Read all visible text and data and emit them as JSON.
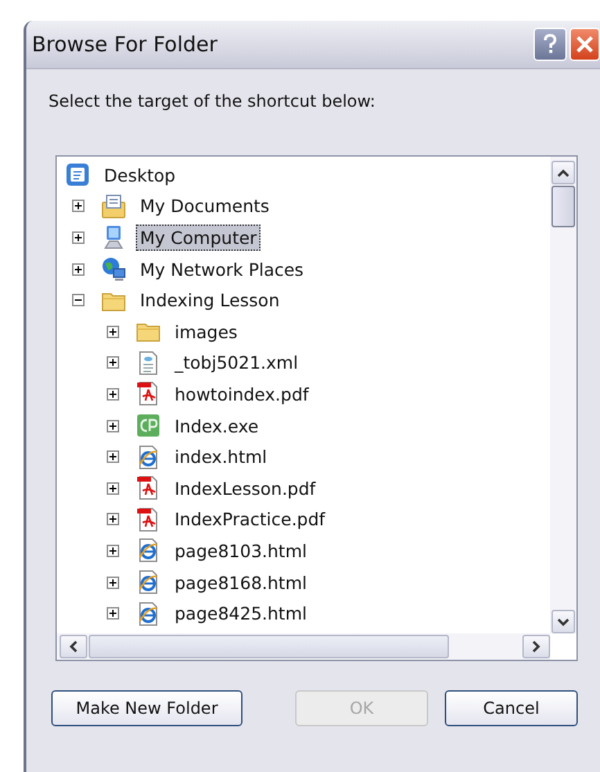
{
  "window": {
    "title": "Browse For Folder"
  },
  "instruction": "Select the target of the shortcut below:",
  "tree": {
    "label": "Desktop",
    "kind": "desktop",
    "selected": false,
    "children": [
      {
        "label": "My Documents",
        "kind": "documents",
        "expanded": false,
        "selected": false
      },
      {
        "label": "My Computer",
        "kind": "computer",
        "expanded": false,
        "selected": true
      },
      {
        "label": "My Network Places",
        "kind": "network",
        "expanded": false,
        "selected": false
      },
      {
        "label": "Indexing Lesson",
        "kind": "folder",
        "expanded": true,
        "selected": false,
        "children": [
          {
            "label": "images",
            "kind": "folder",
            "expanded": false,
            "selected": false
          },
          {
            "label": "_tobj5021.xml",
            "kind": "xml",
            "expanded": false,
            "selected": false
          },
          {
            "label": "howtoindex.pdf",
            "kind": "pdf",
            "expanded": false,
            "selected": false
          },
          {
            "label": "Index.exe",
            "kind": "exe",
            "expanded": false,
            "selected": false
          },
          {
            "label": "index.html",
            "kind": "html",
            "expanded": false,
            "selected": false
          },
          {
            "label": "IndexLesson.pdf",
            "kind": "pdf",
            "expanded": false,
            "selected": false
          },
          {
            "label": "IndexPractice.pdf",
            "kind": "pdf",
            "expanded": false,
            "selected": false
          },
          {
            "label": "page8103.html",
            "kind": "html",
            "expanded": false,
            "selected": false
          },
          {
            "label": "page8168.html",
            "kind": "html",
            "expanded": false,
            "selected": false
          },
          {
            "label": "page8425.html",
            "kind": "html",
            "expanded": false,
            "selected": false
          }
        ]
      }
    ]
  },
  "buttons": [
    {
      "label": "Make New Folder",
      "disabled": false
    },
    {
      "label": "OK",
      "disabled": true
    },
    {
      "label": "Cancel",
      "disabled": false
    }
  ]
}
